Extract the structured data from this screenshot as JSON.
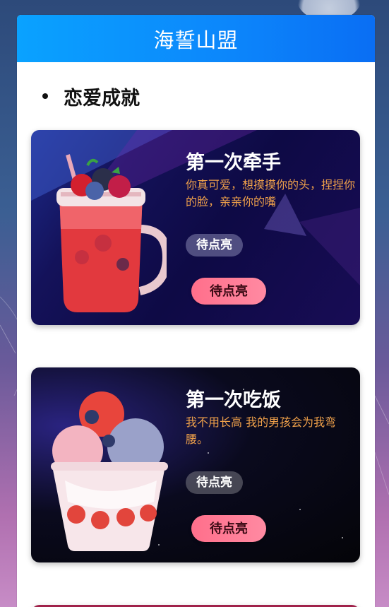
{
  "header": {
    "title": "海誓山盟"
  },
  "section": {
    "title": "恋爱成就"
  },
  "cards": [
    {
      "title": "第一次牵手",
      "description": "你真可爱，想摸摸你的头，捏捏你的脸，亲亲你的嘴",
      "status": "待点亮",
      "button": "待点亮",
      "icon": "berry-drink-jar-icon"
    },
    {
      "title": "第一次吃饭",
      "description": "我不用长高 我的男孩会为我弯腰。",
      "status": "待点亮",
      "button": "待点亮",
      "icon": "ice-cream-cup-icon"
    }
  ],
  "colors": {
    "header": "#0c86fb",
    "description": "#f0a14a",
    "button": "#ff7a94"
  }
}
